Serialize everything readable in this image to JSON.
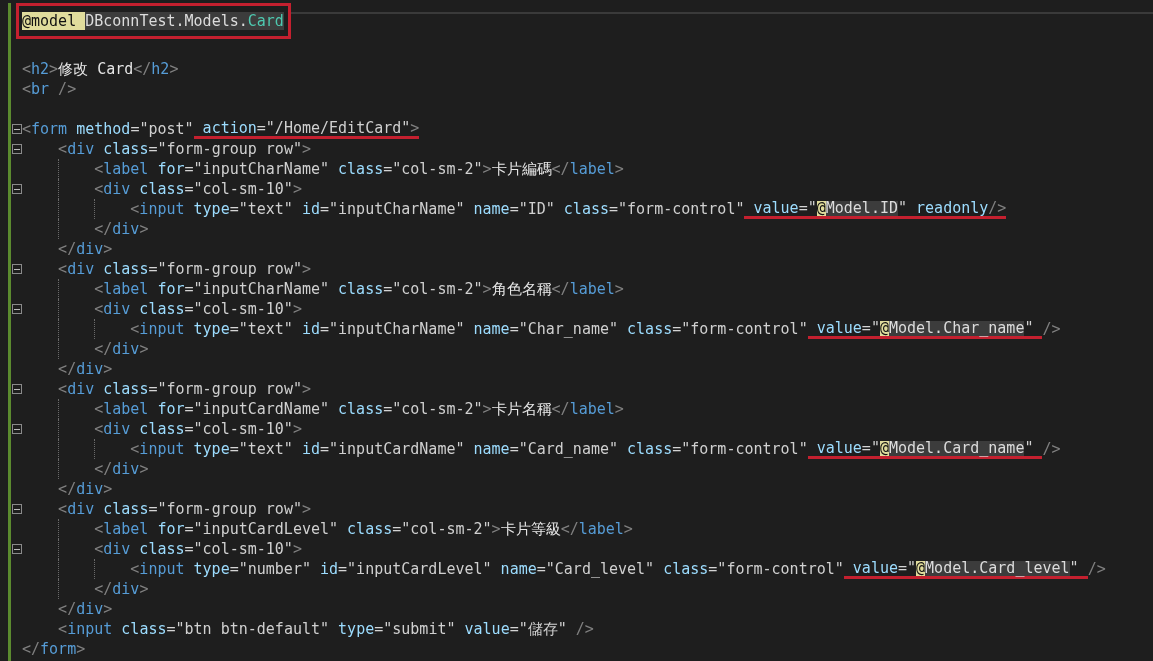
{
  "editor": {
    "lines": [
      {
        "kind": "code",
        "framed": true,
        "current": true,
        "tokens": [
          {
            "kind": "directive",
            "t": "@model "
          },
          {
            "kind": "namespace",
            "t": "DBconnTest.Models."
          },
          {
            "kind": "type",
            "t": "Card"
          }
        ]
      },
      {
        "kind": "blank"
      },
      {
        "kind": "code",
        "tokens": [
          {
            "kind": "punct",
            "t": "<"
          },
          {
            "kind": "tag",
            "t": "h2"
          },
          {
            "kind": "punct",
            "t": ">"
          },
          {
            "kind": "text",
            "t": "修改 Card"
          },
          {
            "kind": "punct",
            "t": "</"
          },
          {
            "kind": "tag",
            "t": "h2"
          },
          {
            "kind": "punct",
            "t": ">"
          }
        ]
      },
      {
        "kind": "code",
        "tokens": [
          {
            "kind": "punct",
            "t": "<"
          },
          {
            "kind": "tag",
            "t": "br"
          },
          {
            "kind": "punct",
            "t": " />"
          }
        ]
      },
      {
        "kind": "blank"
      },
      {
        "kind": "code",
        "expanded": true,
        "tokens": [
          {
            "kind": "punct",
            "t": "<"
          },
          {
            "kind": "tag",
            "t": "form"
          },
          {
            "kind": "attr",
            "t": " method"
          },
          {
            "kind": "op",
            "t": "="
          },
          {
            "kind": "string",
            "t": "\"post\""
          },
          {
            "kind": "underline",
            "tokens": [
              {
                "kind": "attr",
                "t": " action"
              },
              {
                "kind": "op",
                "t": "="
              },
              {
                "kind": "string",
                "t": "\"/Home/EditCard\""
              },
              {
                "kind": "punct",
                "t": ">"
              }
            ]
          }
        ],
        "children": [
          {
            "kind": "code",
            "expanded": true,
            "tokens": [
              {
                "kind": "punct",
                "t": "<"
              },
              {
                "kind": "tag",
                "t": "div"
              },
              {
                "kind": "attr",
                "t": " class"
              },
              {
                "kind": "op",
                "t": "="
              },
              {
                "kind": "string",
                "t": "\"form-group row\""
              },
              {
                "kind": "punct",
                "t": ">"
              }
            ],
            "children": [
              {
                "kind": "code",
                "tokens": [
                  {
                    "kind": "punct",
                    "t": "<"
                  },
                  {
                    "kind": "tag",
                    "t": "label"
                  },
                  {
                    "kind": "attr",
                    "t": " for"
                  },
                  {
                    "kind": "op",
                    "t": "="
                  },
                  {
                    "kind": "string",
                    "t": "\"inputCharName\""
                  },
                  {
                    "kind": "attr",
                    "t": " class"
                  },
                  {
                    "kind": "op",
                    "t": "="
                  },
                  {
                    "kind": "string",
                    "t": "\"col-sm-2\""
                  },
                  {
                    "kind": "punct",
                    "t": ">"
                  },
                  {
                    "kind": "text",
                    "t": "卡片編碼"
                  },
                  {
                    "kind": "punct",
                    "t": "</"
                  },
                  {
                    "kind": "tag",
                    "t": "label"
                  },
                  {
                    "kind": "punct",
                    "t": ">"
                  }
                ]
              },
              {
                "kind": "code",
                "expanded": true,
                "tokens": [
                  {
                    "kind": "punct",
                    "t": "<"
                  },
                  {
                    "kind": "tag",
                    "t": "div"
                  },
                  {
                    "kind": "attr",
                    "t": " class"
                  },
                  {
                    "kind": "op",
                    "t": "="
                  },
                  {
                    "kind": "string",
                    "t": "\"col-sm-10\""
                  },
                  {
                    "kind": "punct",
                    "t": ">"
                  }
                ],
                "children": [
                  {
                    "kind": "code",
                    "tokens": [
                      {
                        "kind": "punct",
                        "t": "<"
                      },
                      {
                        "kind": "tag",
                        "t": "input"
                      },
                      {
                        "kind": "attr",
                        "t": " type"
                      },
                      {
                        "kind": "op",
                        "t": "="
                      },
                      {
                        "kind": "string",
                        "t": "\"text\""
                      },
                      {
                        "kind": "attr",
                        "t": " id"
                      },
                      {
                        "kind": "op",
                        "t": "="
                      },
                      {
                        "kind": "string",
                        "t": "\"inputCharName\""
                      },
                      {
                        "kind": "attr",
                        "t": " name"
                      },
                      {
                        "kind": "op",
                        "t": "="
                      },
                      {
                        "kind": "string",
                        "t": "\"ID\""
                      },
                      {
                        "kind": "attr",
                        "t": " class"
                      },
                      {
                        "kind": "op",
                        "t": "="
                      },
                      {
                        "kind": "string",
                        "t": "\"form-control\""
                      },
                      {
                        "kind": "underline",
                        "tokens": [
                          {
                            "kind": "attr",
                            "t": " value"
                          },
                          {
                            "kind": "op",
                            "t": "="
                          },
                          {
                            "kind": "string",
                            "t": "\""
                          },
                          {
                            "kind": "razor-at",
                            "t": "@"
                          },
                          {
                            "kind": "razor-expr",
                            "t": "Model.ID"
                          },
                          {
                            "kind": "string",
                            "t": "\""
                          },
                          {
                            "kind": "attr",
                            "t": " readonly"
                          },
                          {
                            "kind": "punct",
                            "t": "/>"
                          }
                        ]
                      }
                    ]
                  }
                ]
              },
              {
                "kind": "code",
                "tokens": [
                  {
                    "kind": "punct",
                    "t": "</"
                  },
                  {
                    "kind": "tag",
                    "t": "div"
                  },
                  {
                    "kind": "punct",
                    "t": ">"
                  }
                ]
              }
            ]
          },
          {
            "kind": "code",
            "tokens": [
              {
                "kind": "punct",
                "t": "</"
              },
              {
                "kind": "tag",
                "t": "div"
              },
              {
                "kind": "punct",
                "t": ">"
              }
            ]
          },
          {
            "kind": "code",
            "expanded": true,
            "tokens": [
              {
                "kind": "punct",
                "t": "<"
              },
              {
                "kind": "tag",
                "t": "div"
              },
              {
                "kind": "attr",
                "t": " class"
              },
              {
                "kind": "op",
                "t": "="
              },
              {
                "kind": "string",
                "t": "\"form-group row\""
              },
              {
                "kind": "punct",
                "t": ">"
              }
            ],
            "children": [
              {
                "kind": "code",
                "tokens": [
                  {
                    "kind": "punct",
                    "t": "<"
                  },
                  {
                    "kind": "tag",
                    "t": "label"
                  },
                  {
                    "kind": "attr",
                    "t": " for"
                  },
                  {
                    "kind": "op",
                    "t": "="
                  },
                  {
                    "kind": "string",
                    "t": "\"inputCharName\""
                  },
                  {
                    "kind": "attr",
                    "t": " class"
                  },
                  {
                    "kind": "op",
                    "t": "="
                  },
                  {
                    "kind": "string",
                    "t": "\"col-sm-2\""
                  },
                  {
                    "kind": "punct",
                    "t": ">"
                  },
                  {
                    "kind": "text",
                    "t": "角色名稱"
                  },
                  {
                    "kind": "punct",
                    "t": "</"
                  },
                  {
                    "kind": "tag",
                    "t": "label"
                  },
                  {
                    "kind": "punct",
                    "t": ">"
                  }
                ]
              },
              {
                "kind": "code",
                "expanded": true,
                "tokens": [
                  {
                    "kind": "punct",
                    "t": "<"
                  },
                  {
                    "kind": "tag",
                    "t": "div"
                  },
                  {
                    "kind": "attr",
                    "t": " class"
                  },
                  {
                    "kind": "op",
                    "t": "="
                  },
                  {
                    "kind": "string",
                    "t": "\"col-sm-10\""
                  },
                  {
                    "kind": "punct",
                    "t": ">"
                  }
                ],
                "children": [
                  {
                    "kind": "code",
                    "tokens": [
                      {
                        "kind": "punct",
                        "t": "<"
                      },
                      {
                        "kind": "tag",
                        "t": "input"
                      },
                      {
                        "kind": "attr",
                        "t": " type"
                      },
                      {
                        "kind": "op",
                        "t": "="
                      },
                      {
                        "kind": "string",
                        "t": "\"text\""
                      },
                      {
                        "kind": "attr",
                        "t": " id"
                      },
                      {
                        "kind": "op",
                        "t": "="
                      },
                      {
                        "kind": "string",
                        "t": "\"inputCharName\""
                      },
                      {
                        "kind": "attr",
                        "t": " name"
                      },
                      {
                        "kind": "op",
                        "t": "="
                      },
                      {
                        "kind": "string",
                        "t": "\"Char_name\""
                      },
                      {
                        "kind": "attr",
                        "t": " class"
                      },
                      {
                        "kind": "op",
                        "t": "="
                      },
                      {
                        "kind": "string",
                        "t": "\"form-control\""
                      },
                      {
                        "kind": "underline",
                        "tokens": [
                          {
                            "kind": "attr",
                            "t": " value"
                          },
                          {
                            "kind": "op",
                            "t": "="
                          },
                          {
                            "kind": "string",
                            "t": "\""
                          },
                          {
                            "kind": "razor-at",
                            "t": "@"
                          },
                          {
                            "kind": "razor-expr",
                            "t": "Model.Char_name"
                          },
                          {
                            "kind": "string",
                            "t": "\" "
                          }
                        ]
                      },
                      {
                        "kind": "punct",
                        "t": "/>"
                      }
                    ]
                  }
                ]
              },
              {
                "kind": "code",
                "tokens": [
                  {
                    "kind": "punct",
                    "t": "</"
                  },
                  {
                    "kind": "tag",
                    "t": "div"
                  },
                  {
                    "kind": "punct",
                    "t": ">"
                  }
                ]
              }
            ]
          },
          {
            "kind": "code",
            "tokens": [
              {
                "kind": "punct",
                "t": "</"
              },
              {
                "kind": "tag",
                "t": "div"
              },
              {
                "kind": "punct",
                "t": ">"
              }
            ]
          },
          {
            "kind": "code",
            "expanded": true,
            "tokens": [
              {
                "kind": "punct",
                "t": "<"
              },
              {
                "kind": "tag",
                "t": "div"
              },
              {
                "kind": "attr",
                "t": " class"
              },
              {
                "kind": "op",
                "t": "="
              },
              {
                "kind": "string",
                "t": "\"form-group row\""
              },
              {
                "kind": "punct",
                "t": ">"
              }
            ],
            "children": [
              {
                "kind": "code",
                "tokens": [
                  {
                    "kind": "punct",
                    "t": "<"
                  },
                  {
                    "kind": "tag",
                    "t": "label"
                  },
                  {
                    "kind": "attr",
                    "t": " for"
                  },
                  {
                    "kind": "op",
                    "t": "="
                  },
                  {
                    "kind": "string",
                    "t": "\"inputCardName\""
                  },
                  {
                    "kind": "attr",
                    "t": " class"
                  },
                  {
                    "kind": "op",
                    "t": "="
                  },
                  {
                    "kind": "string",
                    "t": "\"col-sm-2\""
                  },
                  {
                    "kind": "punct",
                    "t": ">"
                  },
                  {
                    "kind": "text",
                    "t": "卡片名稱"
                  },
                  {
                    "kind": "punct",
                    "t": "</"
                  },
                  {
                    "kind": "tag",
                    "t": "label"
                  },
                  {
                    "kind": "punct",
                    "t": ">"
                  }
                ]
              },
              {
                "kind": "code",
                "expanded": true,
                "tokens": [
                  {
                    "kind": "punct",
                    "t": "<"
                  },
                  {
                    "kind": "tag",
                    "t": "div"
                  },
                  {
                    "kind": "attr",
                    "t": " class"
                  },
                  {
                    "kind": "op",
                    "t": "="
                  },
                  {
                    "kind": "string",
                    "t": "\"col-sm-10\""
                  },
                  {
                    "kind": "punct",
                    "t": ">"
                  }
                ],
                "children": [
                  {
                    "kind": "code",
                    "tokens": [
                      {
                        "kind": "punct",
                        "t": "<"
                      },
                      {
                        "kind": "tag",
                        "t": "input"
                      },
                      {
                        "kind": "attr",
                        "t": " type"
                      },
                      {
                        "kind": "op",
                        "t": "="
                      },
                      {
                        "kind": "string",
                        "t": "\"text\""
                      },
                      {
                        "kind": "attr",
                        "t": " id"
                      },
                      {
                        "kind": "op",
                        "t": "="
                      },
                      {
                        "kind": "string",
                        "t": "\"inputCardName\""
                      },
                      {
                        "kind": "attr",
                        "t": " name"
                      },
                      {
                        "kind": "op",
                        "t": "="
                      },
                      {
                        "kind": "string",
                        "t": "\"Card_name\""
                      },
                      {
                        "kind": "attr",
                        "t": " class"
                      },
                      {
                        "kind": "op",
                        "t": "="
                      },
                      {
                        "kind": "string",
                        "t": "\"form-control\""
                      },
                      {
                        "kind": "underline",
                        "tokens": [
                          {
                            "kind": "attr",
                            "t": " value"
                          },
                          {
                            "kind": "op",
                            "t": "="
                          },
                          {
                            "kind": "string",
                            "t": "\""
                          },
                          {
                            "kind": "razor-at",
                            "t": "@"
                          },
                          {
                            "kind": "razor-expr",
                            "t": "Model.Card_name"
                          },
                          {
                            "kind": "string",
                            "t": "\" "
                          }
                        ]
                      },
                      {
                        "kind": "punct",
                        "t": "/>"
                      }
                    ]
                  }
                ]
              },
              {
                "kind": "code",
                "tokens": [
                  {
                    "kind": "punct",
                    "t": "</"
                  },
                  {
                    "kind": "tag",
                    "t": "div"
                  },
                  {
                    "kind": "punct",
                    "t": ">"
                  }
                ]
              }
            ]
          },
          {
            "kind": "code",
            "tokens": [
              {
                "kind": "punct",
                "t": "</"
              },
              {
                "kind": "tag",
                "t": "div"
              },
              {
                "kind": "punct",
                "t": ">"
              }
            ]
          },
          {
            "kind": "code",
            "expanded": true,
            "tokens": [
              {
                "kind": "punct",
                "t": "<"
              },
              {
                "kind": "tag",
                "t": "div"
              },
              {
                "kind": "attr",
                "t": " class"
              },
              {
                "kind": "op",
                "t": "="
              },
              {
                "kind": "string",
                "t": "\"form-group row\""
              },
              {
                "kind": "punct",
                "t": ">"
              }
            ],
            "children": [
              {
                "kind": "code",
                "tokens": [
                  {
                    "kind": "punct",
                    "t": "<"
                  },
                  {
                    "kind": "tag",
                    "t": "label"
                  },
                  {
                    "kind": "attr",
                    "t": " for"
                  },
                  {
                    "kind": "op",
                    "t": "="
                  },
                  {
                    "kind": "string",
                    "t": "\"inputCardLevel\""
                  },
                  {
                    "kind": "attr",
                    "t": " class"
                  },
                  {
                    "kind": "op",
                    "t": "="
                  },
                  {
                    "kind": "string",
                    "t": "\"col-sm-2\""
                  },
                  {
                    "kind": "punct",
                    "t": ">"
                  },
                  {
                    "kind": "text",
                    "t": "卡片等級"
                  },
                  {
                    "kind": "punct",
                    "t": "</"
                  },
                  {
                    "kind": "tag",
                    "t": "label"
                  },
                  {
                    "kind": "punct",
                    "t": ">"
                  }
                ]
              },
              {
                "kind": "code",
                "expanded": true,
                "tokens": [
                  {
                    "kind": "punct",
                    "t": "<"
                  },
                  {
                    "kind": "tag",
                    "t": "div"
                  },
                  {
                    "kind": "attr",
                    "t": " class"
                  },
                  {
                    "kind": "op",
                    "t": "="
                  },
                  {
                    "kind": "string",
                    "t": "\"col-sm-10\""
                  },
                  {
                    "kind": "punct",
                    "t": ">"
                  }
                ],
                "children": [
                  {
                    "kind": "code",
                    "tokens": [
                      {
                        "kind": "punct",
                        "t": "<"
                      },
                      {
                        "kind": "tag",
                        "t": "input"
                      },
                      {
                        "kind": "attr",
                        "t": " type"
                      },
                      {
                        "kind": "op",
                        "t": "="
                      },
                      {
                        "kind": "string",
                        "t": "\"number\""
                      },
                      {
                        "kind": "attr",
                        "t": " id"
                      },
                      {
                        "kind": "op",
                        "t": "="
                      },
                      {
                        "kind": "string",
                        "t": "\"inputCardLevel\""
                      },
                      {
                        "kind": "attr",
                        "t": " name"
                      },
                      {
                        "kind": "op",
                        "t": "="
                      },
                      {
                        "kind": "string",
                        "t": "\"Card_level\""
                      },
                      {
                        "kind": "attr",
                        "t": " class"
                      },
                      {
                        "kind": "op",
                        "t": "="
                      },
                      {
                        "kind": "string",
                        "t": "\"form-control\""
                      },
                      {
                        "kind": "underline",
                        "tokens": [
                          {
                            "kind": "attr",
                            "t": " value"
                          },
                          {
                            "kind": "op",
                            "t": "="
                          },
                          {
                            "kind": "string",
                            "t": "\""
                          },
                          {
                            "kind": "razor-at",
                            "t": "@"
                          },
                          {
                            "kind": "razor-expr",
                            "t": "Model.Card_level"
                          },
                          {
                            "kind": "string",
                            "t": "\" "
                          }
                        ]
                      },
                      {
                        "kind": "punct",
                        "t": "/>"
                      }
                    ]
                  }
                ]
              },
              {
                "kind": "code",
                "tokens": [
                  {
                    "kind": "punct",
                    "t": "</"
                  },
                  {
                    "kind": "tag",
                    "t": "div"
                  },
                  {
                    "kind": "punct",
                    "t": ">"
                  }
                ]
              }
            ]
          },
          {
            "kind": "code",
            "tokens": [
              {
                "kind": "punct",
                "t": "</"
              },
              {
                "kind": "tag",
                "t": "div"
              },
              {
                "kind": "punct",
                "t": ">"
              }
            ]
          },
          {
            "kind": "code",
            "tokens": [
              {
                "kind": "punct",
                "t": "<"
              },
              {
                "kind": "tag",
                "t": "input"
              },
              {
                "kind": "attr",
                "t": " class"
              },
              {
                "kind": "op",
                "t": "="
              },
              {
                "kind": "string",
                "t": "\"btn btn-default\""
              },
              {
                "kind": "attr",
                "t": " type"
              },
              {
                "kind": "op",
                "t": "="
              },
              {
                "kind": "string",
                "t": "\"submit\""
              },
              {
                "kind": "attr",
                "t": " value"
              },
              {
                "kind": "op",
                "t": "="
              },
              {
                "kind": "string",
                "t": "\"儲存\""
              },
              {
                "kind": "punct",
                "t": " />"
              }
            ]
          }
        ]
      },
      {
        "kind": "code",
        "tokens": [
          {
            "kind": "punct",
            "t": "</"
          },
          {
            "kind": "tag",
            "t": "form"
          },
          {
            "kind": "punct",
            "t": ">"
          }
        ]
      }
    ]
  }
}
